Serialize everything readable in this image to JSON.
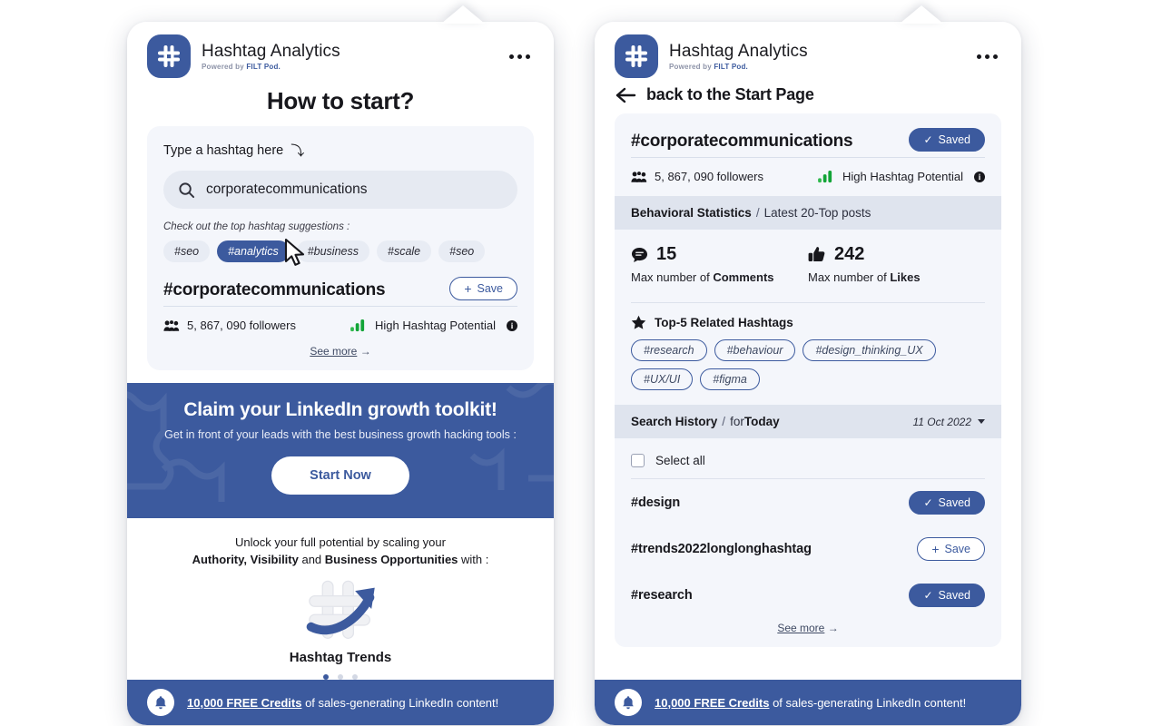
{
  "app": {
    "title": "Hashtag Analytics",
    "powered_prefix": "Powered by ",
    "powered_brand": "FILT Pod.",
    "logo_icon": "hashtag-logo-icon",
    "menu_icon": "kebab-menu-icon",
    "accent_blue": "#3c5a9e",
    "panel_bg": "#f4f6fb",
    "green": "#12a437"
  },
  "left": {
    "page_title": "How to start?",
    "search": {
      "label": "Type a hashtag here",
      "label_icon": "arrow-down-right-icon",
      "search_icon": "search-icon",
      "value": "corporatecommunications",
      "placeholder": "Type a hashtag here"
    },
    "suggestions_note": "Check out the top hashtag suggestions :",
    "suggestions": [
      {
        "label": "#seo",
        "active": false
      },
      {
        "label": "#analytics",
        "active": true
      },
      {
        "label": "#business",
        "active": false
      },
      {
        "label": "#scale",
        "active": false
      },
      {
        "label": "#seo",
        "active": false
      }
    ],
    "result": {
      "hashtag": "#corporatecommunications",
      "save_label": "Save",
      "save_icon": "plus-icon",
      "followers_icon": "people-icon",
      "followers": "5, 867, 090 followers",
      "potential_icon": "signal-bars-icon",
      "potential": "High Hashtag Potential",
      "info_icon": "info-icon",
      "info_char": "i",
      "see_more": "See more",
      "see_more_icon": "arrow-right-icon"
    },
    "promo": {
      "title": "Claim your LinkedIn growth toolkit!",
      "subtitle": "Get in front of your leads with the best business growth hacking tools :",
      "cta": "Start Now"
    },
    "unlock": {
      "line1": "Unlock your full potential by scaling your",
      "bold1": "Authority, Visibility",
      "mid": " and ",
      "bold2": "Business Opportunities",
      "tail": " with :",
      "feature_icon": "hashtag-trend-arrow-icon",
      "feature_label": "Hashtag Trends",
      "dots_total": 3,
      "dots_active": 0
    }
  },
  "right": {
    "back": {
      "icon": "arrow-left-icon",
      "label": "back to the Start Page"
    },
    "header": {
      "hashtag": "#corporatecommunications",
      "saved_label": "Saved",
      "saved_icon": "check-icon",
      "followers_icon": "people-icon",
      "followers": "5, 867, 090 followers",
      "potential_icon": "signal-bars-icon",
      "potential": "High Hashtag Potential",
      "info_icon": "info-icon",
      "info_char": "i"
    },
    "behavioral": {
      "title": "Behavioral Statistics",
      "slash": "/",
      "subtitle": "Latest 20-Top posts",
      "stats": [
        {
          "icon": "comment-icon",
          "value": "15",
          "caption_prefix": "Max number of ",
          "caption_bold": "Comments"
        },
        {
          "icon": "thumbs-up-icon",
          "value": "242",
          "caption_prefix": "Max number of ",
          "caption_bold": "Likes"
        }
      ]
    },
    "related": {
      "icon": "star-icon",
      "title": "Top-5 Related Hashtags",
      "tags": [
        "#research",
        "#behaviour",
        "#design_thinking_UX",
        "#UX/UI",
        "#figma"
      ]
    },
    "history": {
      "title": "Search History",
      "slash": "/",
      "subtitle_prefix": "for ",
      "subtitle_bold": "Today",
      "date": "11 Oct 2022",
      "date_caret_icon": "chevron-down-icon",
      "select_all": "Select all",
      "rows": [
        {
          "hashtag": "#design",
          "action": "Saved",
          "saved": true,
          "icon": "check-icon"
        },
        {
          "hashtag": "#trends2022longlonghashtag",
          "action": "Save",
          "saved": false,
          "icon": "plus-icon"
        },
        {
          "hashtag": "#research",
          "action": "Saved",
          "saved": true,
          "icon": "check-icon"
        }
      ],
      "see_more": "See more",
      "see_more_icon": "arrow-right-icon"
    }
  },
  "footer": {
    "bell_icon": "bell-icon",
    "highlight": "10,000 FREE Credits",
    "rest": " of sales-generating LinkedIn content!"
  },
  "cursor": {
    "icon": "mouse-cursor-icon"
  }
}
